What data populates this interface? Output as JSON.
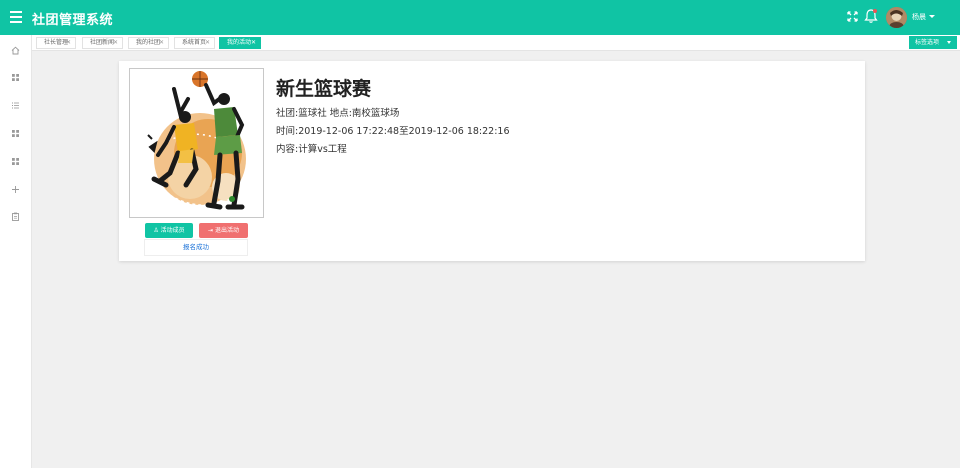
{
  "header": {
    "title": "社团管理系统",
    "user_name": "杨晨"
  },
  "sidebar": {
    "icons": [
      "home-icon",
      "apps-icon",
      "list-icon",
      "apps-icon",
      "apps-icon",
      "plus-icon",
      "clipboard-icon"
    ]
  },
  "tabs": [
    {
      "label": "社长管理",
      "active": false
    },
    {
      "label": "社团新闻",
      "active": false
    },
    {
      "label": "我的社团",
      "active": false
    },
    {
      "label": "系统首页",
      "active": false
    },
    {
      "label": "我的活动",
      "active": true
    }
  ],
  "tab_options_label": "标签选项",
  "event": {
    "title": "新生篮球赛",
    "club_line": "社团:篮球社 地点:南校篮球场",
    "time_line": "时间:2019-12-06 17:22:48至2019-12-06 18:22:16",
    "content_line": "内容:计算vs工程",
    "join_label": "活动成员",
    "quit_label": "退出活动",
    "status": "报名成功"
  },
  "colors": {
    "primary": "#10c4a4",
    "danger": "#f07070",
    "status_text": "#1e73d8"
  }
}
